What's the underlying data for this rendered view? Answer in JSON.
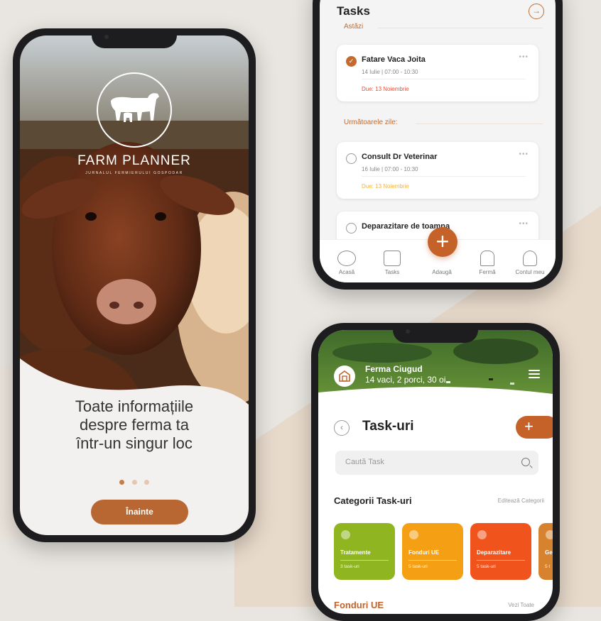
{
  "intro": {
    "brand": "FARM PLANNER",
    "tagline": "JURNALUL FERMIERULUI GOSPODAR",
    "headline": [
      "Toate informațiile",
      "despre ferma ta",
      "într-un singur loc"
    ],
    "next_label": "Înainte",
    "page_dots": 3,
    "active_dot": 1,
    "accent": "#b86632"
  },
  "tasks_screen": {
    "title": "Tasks",
    "today_label": "Astăzi",
    "upcoming_label": "Următoarele zile:",
    "tasks": [
      {
        "title": "Fatare Vaca Joita",
        "time": "14 Iulie | 07:00  - 10:30",
        "due": "Due: 13 Noiembrie",
        "done": true,
        "due_color": "#e0533a"
      },
      {
        "title": "Consult Dr Veterinar",
        "time": "16 Iulie | 07:00  - 10:30",
        "due": "Due: 13 Noiembrie",
        "done": false,
        "due_color": "#f2b33a"
      },
      {
        "title": "Deparazitare de toamna",
        "time": "",
        "due": "",
        "done": false,
        "due_color": ""
      }
    ],
    "more_label": "•••",
    "tabs": [
      "Acasă",
      "Tasks",
      "Adaugă",
      "Fermă",
      "Contul meu"
    ]
  },
  "tasklist_screen": {
    "farm_name": "Ferma Ciugud",
    "farm_stock": "14 vaci, 2 porci, 30 oi",
    "title": "Task-uri",
    "search_placeholder": "Caută Task",
    "categories_title": "Categorii Task-uri",
    "edit_categories": "Editează Categorii",
    "categories": [
      {
        "name": "Tratamente",
        "count": "3 task-uri",
        "color": "#8fb521"
      },
      {
        "name": "Fonduri UE",
        "count": "5 task-uri",
        "color": "#f5a014"
      },
      {
        "name": "Deparazitare",
        "count": "5 task-uri",
        "color": "#f0531c"
      },
      {
        "name": "Ge",
        "count": "5 t",
        "color": "#d6822e"
      }
    ],
    "section_title": "Fonduri UE",
    "see_all": "Vezi Toate",
    "accent": "#c4622a"
  }
}
